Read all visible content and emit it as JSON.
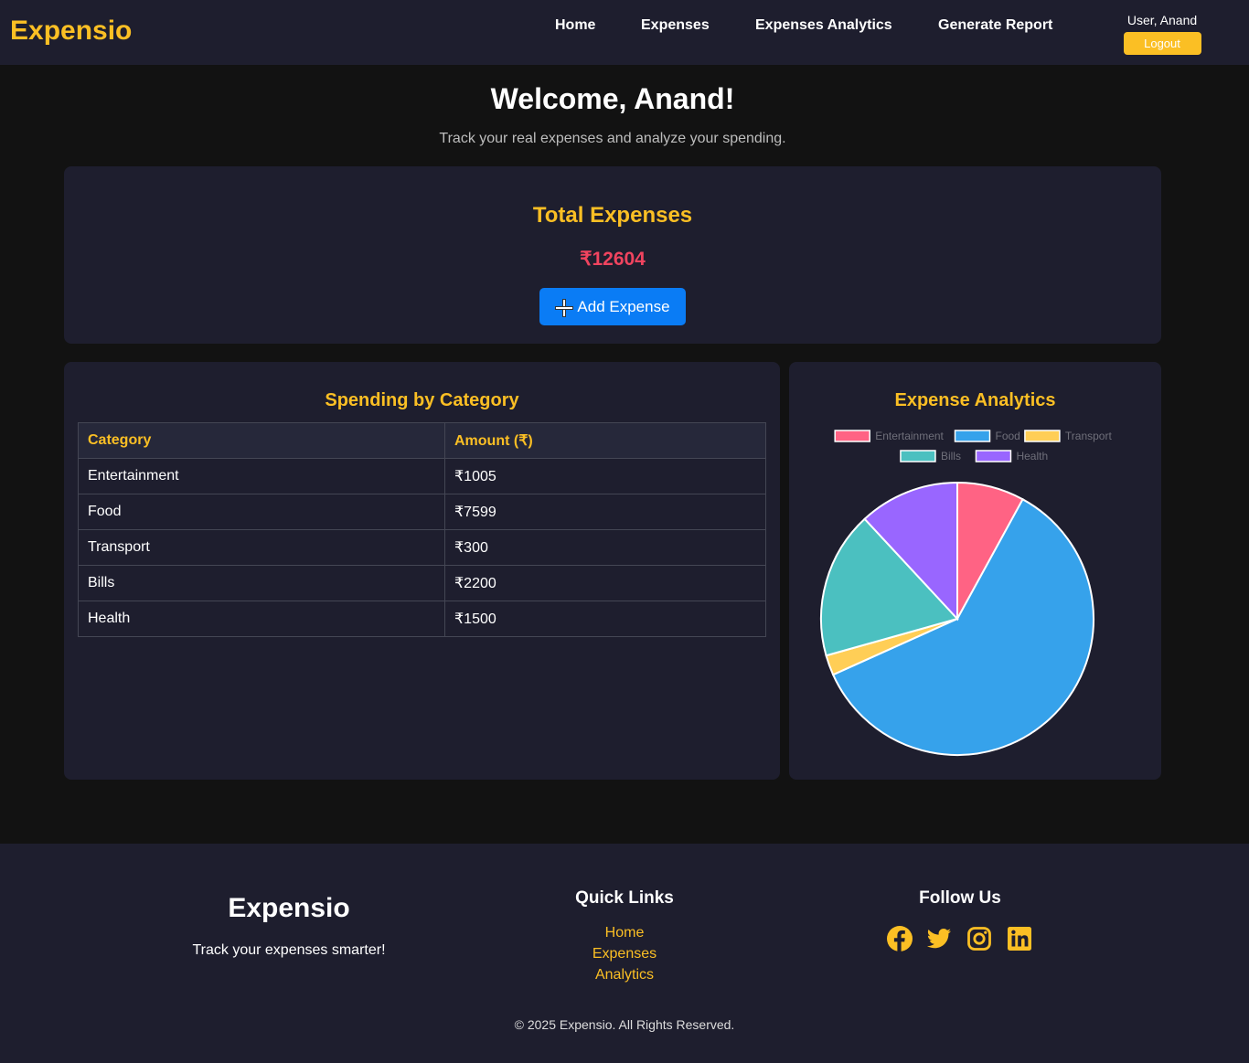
{
  "nav": {
    "brand": "Expensio",
    "links": [
      "Home",
      "Expenses",
      "Expenses Analytics",
      "Generate Report"
    ],
    "user_label": "User, Anand",
    "logout_label": "Logout"
  },
  "welcome": {
    "title": "Welcome, Anand!",
    "subtitle": "Track your real expenses and analyze your spending."
  },
  "total": {
    "title": "Total Expenses",
    "amount": "₹12604",
    "add_button_label": "Add Expense",
    "add_button_icon": "plus-icon"
  },
  "categories": {
    "title": "Spending by Category",
    "headers": [
      "Category",
      "Amount (₹)"
    ],
    "rows": [
      {
        "category": "Entertainment",
        "amount": "₹1005"
      },
      {
        "category": "Food",
        "amount": "₹7599"
      },
      {
        "category": "Transport",
        "amount": "₹300"
      },
      {
        "category": "Bills",
        "amount": "₹2200"
      },
      {
        "category": "Health",
        "amount": "₹1500"
      }
    ]
  },
  "analytics": {
    "title": "Expense Analytics"
  },
  "chart_data": {
    "type": "pie",
    "categories": [
      "Entertainment",
      "Food",
      "Transport",
      "Bills",
      "Health"
    ],
    "values": [
      1005,
      7599,
      300,
      2200,
      1500
    ],
    "colors": [
      "#ff6384",
      "#36a2eb",
      "#ffce56",
      "#4bc0c0",
      "#9966ff"
    ],
    "legend_position": "top"
  },
  "footer": {
    "brand": "Expensio",
    "tagline": "Track your expenses smarter!",
    "quick_links_title": "Quick Links",
    "quick_links": [
      "Home",
      "Expenses",
      "Analytics"
    ],
    "follow_title": "Follow Us",
    "social_icons": [
      "facebook-icon",
      "twitter-icon",
      "instagram-icon",
      "linkedin-icon"
    ],
    "accent_color": "#fbbf24",
    "copyright": "© 2025 Expensio. All Rights Reserved."
  }
}
